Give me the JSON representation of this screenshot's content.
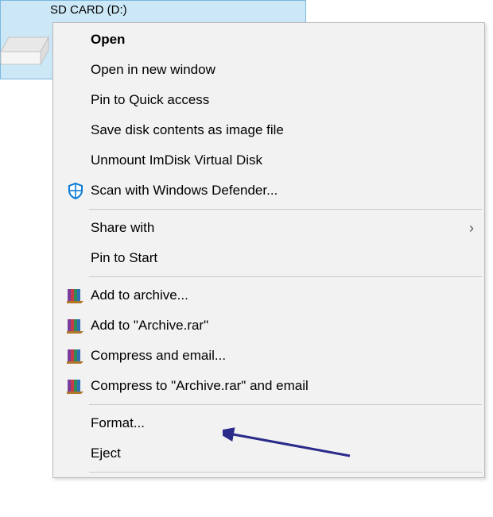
{
  "drive": {
    "label": "SD CARD (D:)"
  },
  "menu": {
    "open": "Open",
    "open_new_window": "Open in new window",
    "pin_quick_access": "Pin to Quick access",
    "save_disk_image": "Save disk contents as image file",
    "unmount_imdisk": "Unmount ImDisk Virtual Disk",
    "scan_defender": "Scan with Windows Defender...",
    "share_with": "Share with",
    "pin_to_start": "Pin to Start",
    "add_to_archive": "Add to archive...",
    "add_to_archive_rar": "Add to \"Archive.rar\"",
    "compress_email": "Compress and email...",
    "compress_archive_email": "Compress to \"Archive.rar\" and email",
    "format": "Format...",
    "eject": "Eject"
  },
  "icons": {
    "submenu_arrow": "›"
  }
}
